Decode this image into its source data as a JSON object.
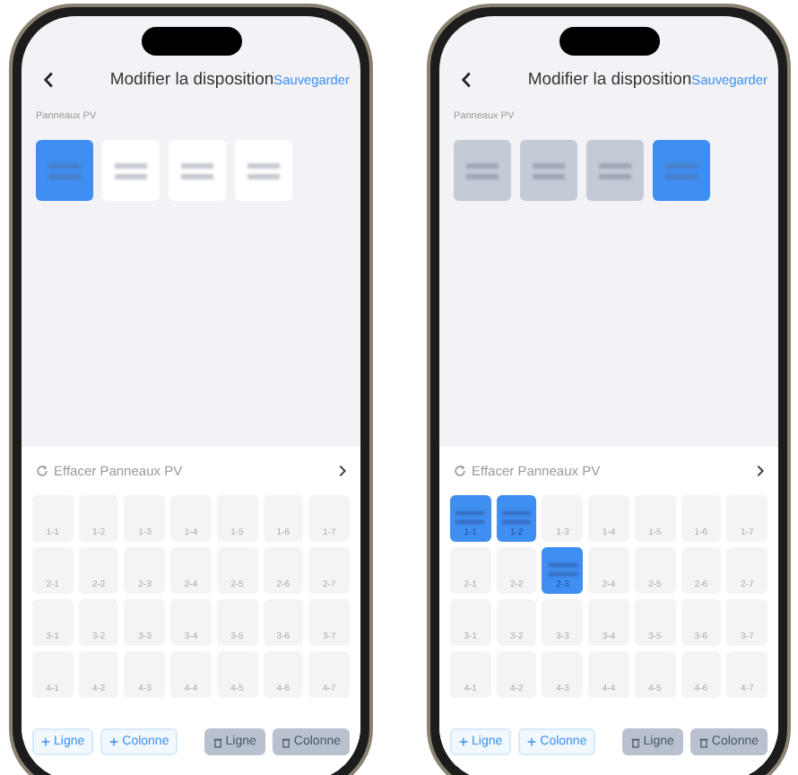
{
  "phones": [
    {
      "header": {
        "title": "Modifier la disposition",
        "save": "Sauvegarder"
      },
      "section_label": "Panneaux PV",
      "panels": [
        {
          "selected": true,
          "placed": false
        },
        {
          "selected": false,
          "placed": false
        },
        {
          "selected": false,
          "placed": false
        },
        {
          "selected": false,
          "placed": false
        }
      ],
      "clear_label": "Effacer Panneaux PV",
      "grid": [
        [
          {
            "label": "1-1",
            "filled": false
          },
          {
            "label": "1-2",
            "filled": false
          },
          {
            "label": "1-3",
            "filled": false
          },
          {
            "label": "1-4",
            "filled": false
          },
          {
            "label": "1-5",
            "filled": false
          },
          {
            "label": "1-6",
            "filled": false
          },
          {
            "label": "1-7",
            "filled": false
          }
        ],
        [
          {
            "label": "2-1",
            "filled": false
          },
          {
            "label": "2-2",
            "filled": false
          },
          {
            "label": "2-3",
            "filled": false
          },
          {
            "label": "2-4",
            "filled": false
          },
          {
            "label": "2-5",
            "filled": false
          },
          {
            "label": "2-6",
            "filled": false
          },
          {
            "label": "2-7",
            "filled": false
          }
        ],
        [
          {
            "label": "3-1",
            "filled": false
          },
          {
            "label": "3-2",
            "filled": false
          },
          {
            "label": "3-3",
            "filled": false
          },
          {
            "label": "3-4",
            "filled": false
          },
          {
            "label": "3-5",
            "filled": false
          },
          {
            "label": "3-6",
            "filled": false
          },
          {
            "label": "3-7",
            "filled": false
          }
        ],
        [
          {
            "label": "4-1",
            "filled": false
          },
          {
            "label": "4-2",
            "filled": false
          },
          {
            "label": "4-3",
            "filled": false
          },
          {
            "label": "4-4",
            "filled": false
          },
          {
            "label": "4-5",
            "filled": false
          },
          {
            "label": "4-6",
            "filled": false
          },
          {
            "label": "4-7",
            "filled": false
          }
        ]
      ],
      "buttons": [
        {
          "kind": "add",
          "label": "Ligne",
          "disabled": false
        },
        {
          "kind": "add",
          "label": "Colonne",
          "disabled": false
        },
        {
          "kind": "delete",
          "label": "Ligne",
          "disabled": true
        },
        {
          "kind": "delete",
          "label": "Colonne",
          "disabled": true
        }
      ]
    },
    {
      "header": {
        "title": "Modifier la disposition",
        "save": "Sauvegarder"
      },
      "section_label": "Panneaux PV",
      "panels": [
        {
          "selected": false,
          "placed": true
        },
        {
          "selected": false,
          "placed": true
        },
        {
          "selected": false,
          "placed": true
        },
        {
          "selected": true,
          "placed": false
        }
      ],
      "clear_label": "Effacer Panneaux PV",
      "grid": [
        [
          {
            "label": "1-1",
            "filled": true
          },
          {
            "label": "1-2",
            "filled": true
          },
          {
            "label": "1-3",
            "filled": false
          },
          {
            "label": "1-4",
            "filled": false
          },
          {
            "label": "1-5",
            "filled": false
          },
          {
            "label": "1-6",
            "filled": false
          },
          {
            "label": "1-7",
            "filled": false
          }
        ],
        [
          {
            "label": "2-1",
            "filled": false
          },
          {
            "label": "2-2",
            "filled": false
          },
          {
            "label": "2-3",
            "filled": true
          },
          {
            "label": "2-4",
            "filled": false
          },
          {
            "label": "2-5",
            "filled": false
          },
          {
            "label": "2-6",
            "filled": false
          },
          {
            "label": "2-7",
            "filled": false
          }
        ],
        [
          {
            "label": "3-1",
            "filled": false
          },
          {
            "label": "3-2",
            "filled": false
          },
          {
            "label": "3-3",
            "filled": false
          },
          {
            "label": "3-4",
            "filled": false
          },
          {
            "label": "3-5",
            "filled": false
          },
          {
            "label": "3-6",
            "filled": false
          },
          {
            "label": "3-7",
            "filled": false
          }
        ],
        [
          {
            "label": "4-1",
            "filled": false
          },
          {
            "label": "4-2",
            "filled": false
          },
          {
            "label": "4-3",
            "filled": false
          },
          {
            "label": "4-4",
            "filled": false
          },
          {
            "label": "4-5",
            "filled": false
          },
          {
            "label": "4-6",
            "filled": false
          },
          {
            "label": "4-7",
            "filled": false
          }
        ]
      ],
      "buttons": [
        {
          "kind": "add",
          "label": "Ligne",
          "disabled": false
        },
        {
          "kind": "add",
          "label": "Colonne",
          "disabled": false
        },
        {
          "kind": "delete",
          "label": "Ligne",
          "disabled": true
        },
        {
          "kind": "delete",
          "label": "Colonne",
          "disabled": true
        }
      ]
    }
  ]
}
